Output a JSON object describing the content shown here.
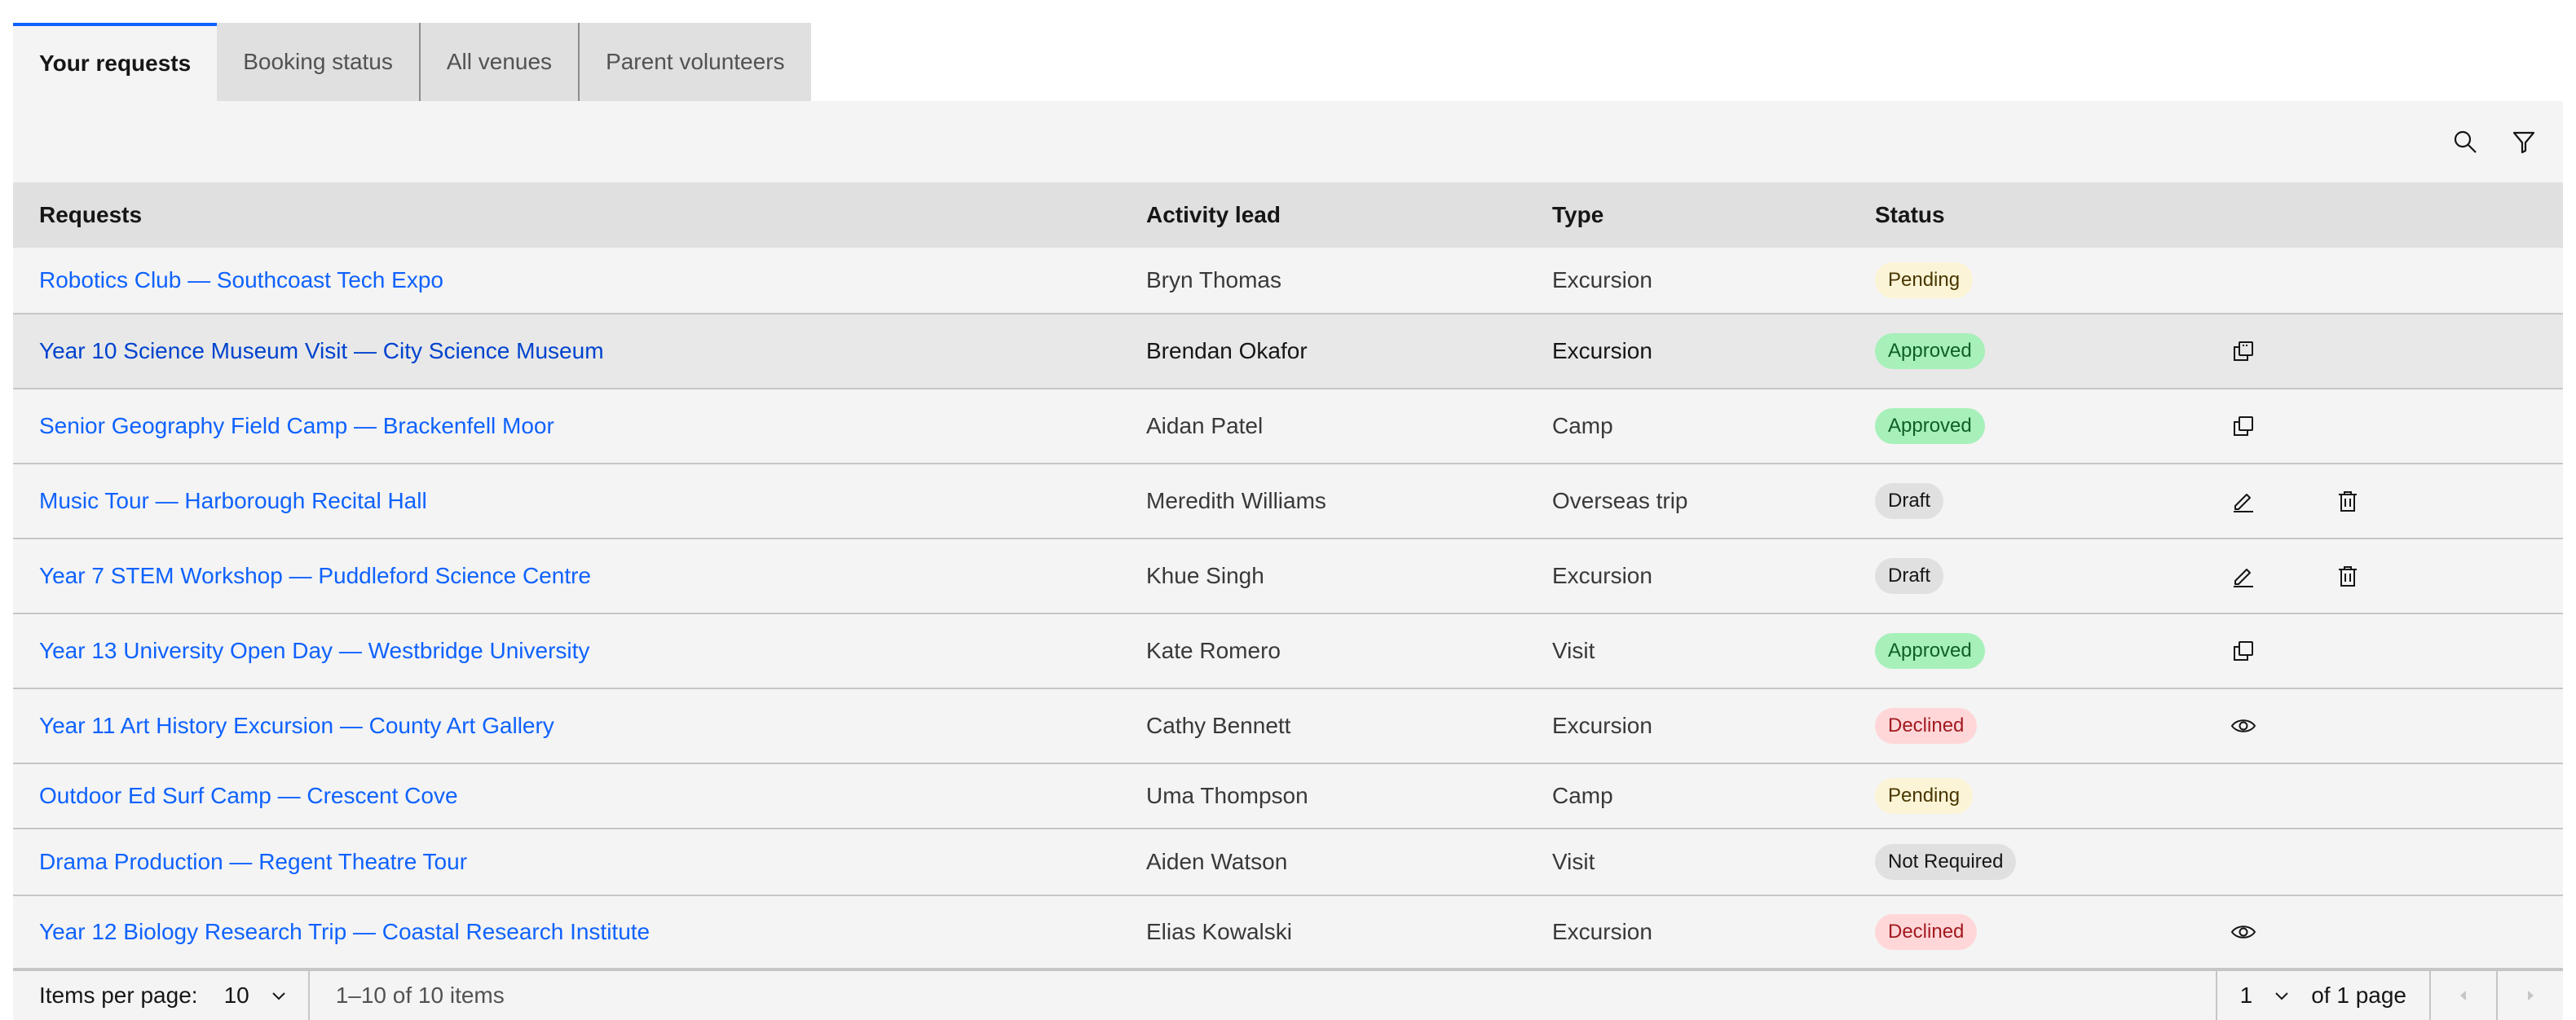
{
  "tabs": [
    {
      "label": "Your requests",
      "active": true
    },
    {
      "label": "Booking status",
      "active": false
    },
    {
      "label": "All venues",
      "active": false
    },
    {
      "label": "Parent volunteers",
      "active": false
    }
  ],
  "toolbar": {
    "search_icon": "search-icon",
    "filter_icon": "filter-icon"
  },
  "table": {
    "headers": [
      "Requests",
      "Activity lead",
      "Type",
      "Status"
    ],
    "rows": [
      {
        "request": "Robotics Club — Southcoast Tech Expo",
        "lead": "Bryn Thomas",
        "type": "Excursion",
        "status": "Pending"
      },
      {
        "request": "Year 10 Science Museum Visit — City Science Museum",
        "lead": "Brendan Okafor",
        "type": "Excursion",
        "status": "Approved"
      },
      {
        "request": "Senior Geography Field Camp — Brackenfell Moor",
        "lead": "Aidan Patel",
        "type": "Camp",
        "status": "Approved"
      },
      {
        "request": "Music Tour — Harborough Recital Hall",
        "lead": "Meredith Williams",
        "type": "Overseas trip",
        "status": "Draft"
      },
      {
        "request": "Year 7 STEM Workshop — Puddleford Science Centre",
        "lead": "Khue Singh",
        "type": "Excursion",
        "status": "Draft"
      },
      {
        "request": "Year 13 University Open Day — Westbridge University",
        "lead": "Kate Romero",
        "type": "Visit",
        "status": "Approved"
      },
      {
        "request": "Year 11 Art History Excursion — County Art Gallery",
        "lead": "Cathy Bennett",
        "type": "Excursion",
        "status": "Declined"
      },
      {
        "request": "Outdoor Ed Surf Camp — Crescent Cove",
        "lead": "Uma Thompson",
        "type": "Camp",
        "status": "Pending"
      },
      {
        "request": "Drama Production — Regent Theatre Tour",
        "lead": "Aiden Watson",
        "type": "Visit",
        "status": "Not Required"
      },
      {
        "request": "Year 12 Biology Research Trip — Coastal Research Institute",
        "lead": "Elias Kowalski",
        "type": "Excursion",
        "status": "Declined"
      }
    ]
  },
  "pagination": {
    "items_per_page_label": "Items per page:",
    "items_per_page_value": "10",
    "range_text": "1–10 of 10 items",
    "page_value": "1",
    "page_total_text": "of 1 page"
  },
  "colors": {
    "link": "#0f62fe",
    "active_tab_border": "#0f62fe",
    "pending_bg": "#fcf4d6",
    "approved_bg": "#a7f0ba",
    "declined_bg": "#ffd7d9",
    "draft_bg": "#e0e0e0"
  }
}
